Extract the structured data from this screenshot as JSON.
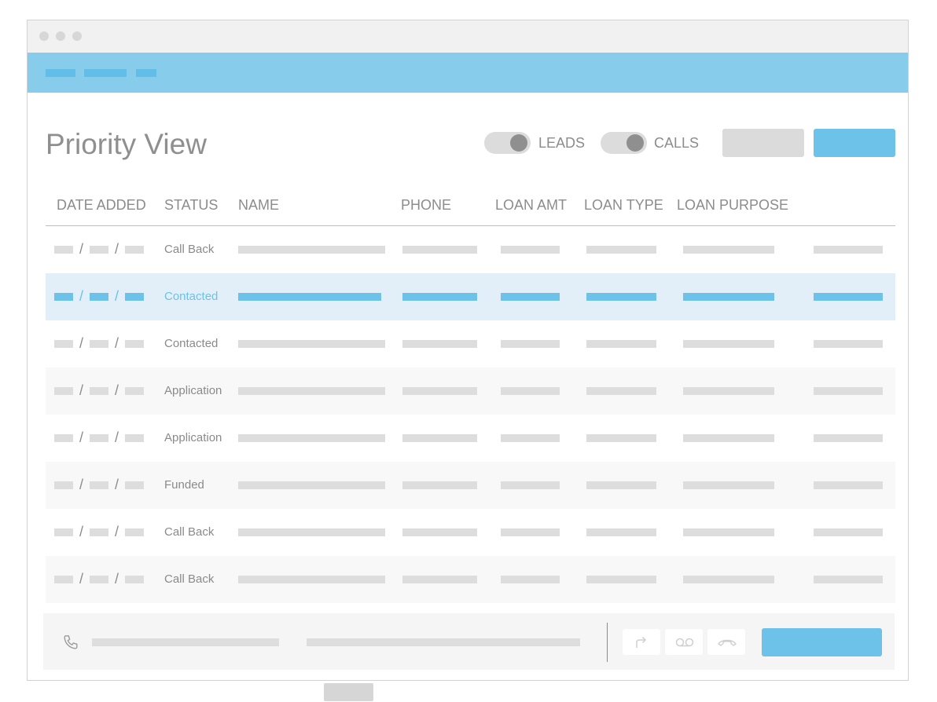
{
  "header": {
    "title": "Priority View",
    "toggles": [
      {
        "label": "LEADS",
        "on": true
      },
      {
        "label": "CALLS",
        "on": true
      }
    ]
  },
  "table": {
    "columns": [
      "DATE ADDED",
      "STATUS",
      "NAME",
      "PHONE",
      "LOAN AMT",
      "LOAN TYPE",
      "LOAN PURPOSE"
    ],
    "date_separator": "/",
    "rows": [
      {
        "status": "Call Back",
        "selected": false
      },
      {
        "status": "Contacted",
        "selected": true
      },
      {
        "status": "Contacted",
        "selected": false
      },
      {
        "status": "Application",
        "selected": false
      },
      {
        "status": "Application",
        "selected": false
      },
      {
        "status": "Funded",
        "selected": false
      },
      {
        "status": "Call Back",
        "selected": false
      },
      {
        "status": "Call Back",
        "selected": false
      }
    ]
  },
  "call_bar": {
    "icons": [
      "phone-icon",
      "forward-icon",
      "voicemail-icon",
      "hangup-icon"
    ]
  },
  "colors": {
    "accent": "#6cc2e8",
    "navbar": "#87cdeb",
    "selected_row": "#e3eff8",
    "placeholder": "#dddddd"
  }
}
